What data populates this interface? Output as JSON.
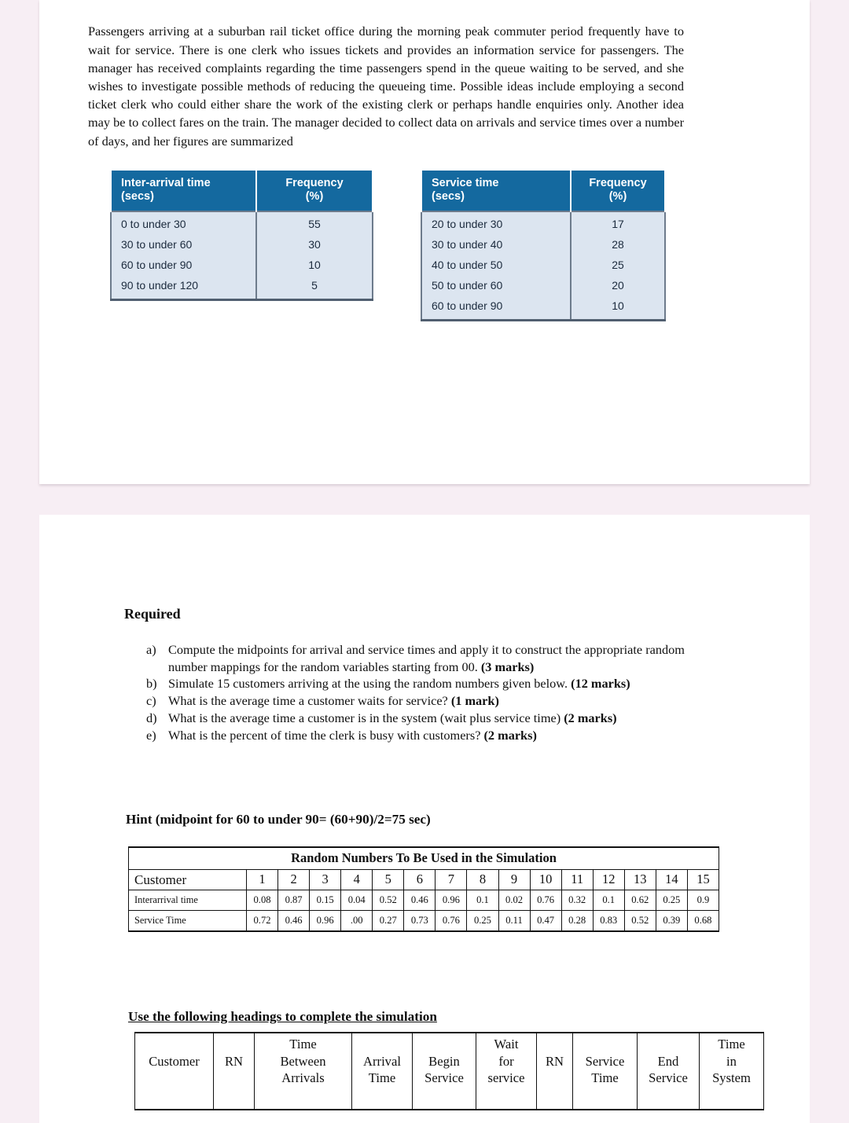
{
  "document": {
    "intro_paragraph": "Passengers arriving at a suburban rail ticket office during the morning peak commuter period frequently have to wait for service. There is one clerk who issues tickets and provides an information service for passengers. The manager has received complaints regarding the time passengers spend in the queue waiting to be served, and she wishes to investigate possible methods of reducing the queueing time. Possible ideas include employing a second ticket clerk who could either share the work of the existing clerk or perhaps handle enquiries only. Another idea may be to collect fares on the train. The manager decided to collect data on arrivals and service times over a number of days, and her figures are summarized"
  },
  "colors": {
    "table_header_blue": "#14699f",
    "table_body_blue": "#dce5f0",
    "page_background": "#f7eef4",
    "page_white": "#ffffff"
  },
  "interarrival_table": {
    "header": {
      "label": "Inter-arrival time (secs)",
      "label_line1": "Inter-arrival time",
      "label_line2": "(secs)",
      "frequency": "Frequency",
      "frequency_unit": "(%)"
    },
    "rows": [
      {
        "range": "0 to under 30",
        "frequency": "55"
      },
      {
        "range": "30 to under 60",
        "frequency": "30"
      },
      {
        "range": "60 to under 90",
        "frequency": "10"
      },
      {
        "range": "90 to under 120",
        "frequency": "5"
      }
    ]
  },
  "service_table": {
    "header": {
      "label_line1": "Service time",
      "label_line2": "(secs)",
      "frequency": "Frequency",
      "frequency_unit": "(%)"
    },
    "rows": [
      {
        "range": "20 to under 30",
        "frequency": "17"
      },
      {
        "range": "30 to under 40",
        "frequency": "28"
      },
      {
        "range": "40 to under 50",
        "frequency": "25"
      },
      {
        "range": "50 to under 60",
        "frequency": "20"
      },
      {
        "range": "60 to under 90",
        "frequency": "10"
      }
    ]
  },
  "required": {
    "heading": "Required",
    "questions": [
      {
        "marker": "a)",
        "text": "Compute the midpoints for arrival and service times and apply it to construct the appropriate random number mappings for the random variables starting from 00. ",
        "marks": "(3 marks)"
      },
      {
        "marker": "b)",
        "text": "Simulate 15 customers arriving at the using the random numbers given below. ",
        "marks": "(12 marks)"
      },
      {
        "marker": "c)",
        "text": "What is the average time a customer waits for service? ",
        "marks": "(1 mark)"
      },
      {
        "marker": "d)",
        "text": "What is the average time a customer  is in the system (wait plus service time) ",
        "marks": "(2 marks)"
      },
      {
        "marker": "e)",
        "text": "What is the percent of time the clerk   is busy with customers? ",
        "marks": "(2 marks)"
      }
    ]
  },
  "hint": "Hint (midpoint for 60 to under 90= (60+90)/2=75 sec)",
  "random_numbers_table": {
    "title": "Random Numbers To Be Used in the Simulation",
    "customer_label": "Customer",
    "customer_numbers": [
      "1",
      "2",
      "3",
      "4",
      "5",
      "6",
      "7",
      "8",
      "9",
      "10",
      "11",
      "12",
      "13",
      "14",
      "15"
    ],
    "rows": [
      {
        "label": "Interarrival time",
        "values": [
          "0.08",
          "0.87",
          "0.15",
          "0.04",
          "0.52",
          "0.46",
          "0.96",
          "0.1",
          "0.02",
          "0.76",
          "0.32",
          "0.1",
          "0.62",
          "0.25",
          "0.9"
        ]
      },
      {
        "label": "Service Time",
        "values": [
          "0.72",
          "0.46",
          "0.96",
          ".00",
          "0.27",
          "0.73",
          "0.76",
          "0.25",
          "0.11",
          "0.47",
          "0.28",
          "0.83",
          "0.52",
          "0.39",
          "0.68"
        ]
      }
    ]
  },
  "headings_section": {
    "title": "Use the following headings to complete the simulation",
    "columns": [
      {
        "line1": "Customer",
        "line2": ""
      },
      {
        "line1": "RN",
        "line2": ""
      },
      {
        "line1": "Time",
        "line2": "Between",
        "line3": "Arrivals"
      },
      {
        "line1": "",
        "line2": "Arrival",
        "line3": "Time"
      },
      {
        "line1": "",
        "line2": "Begin",
        "line3": "Service"
      },
      {
        "line1": "Wait",
        "line2": "for",
        "line3": "service"
      },
      {
        "line1": "",
        "line2": "RN",
        "line3": ""
      },
      {
        "line1": "",
        "line2": "Service",
        "line3": "Time"
      },
      {
        "line1": "",
        "line2": "End",
        "line3": "Service"
      },
      {
        "line1": "Time",
        "line2": "in",
        "line3": "System"
      }
    ]
  }
}
